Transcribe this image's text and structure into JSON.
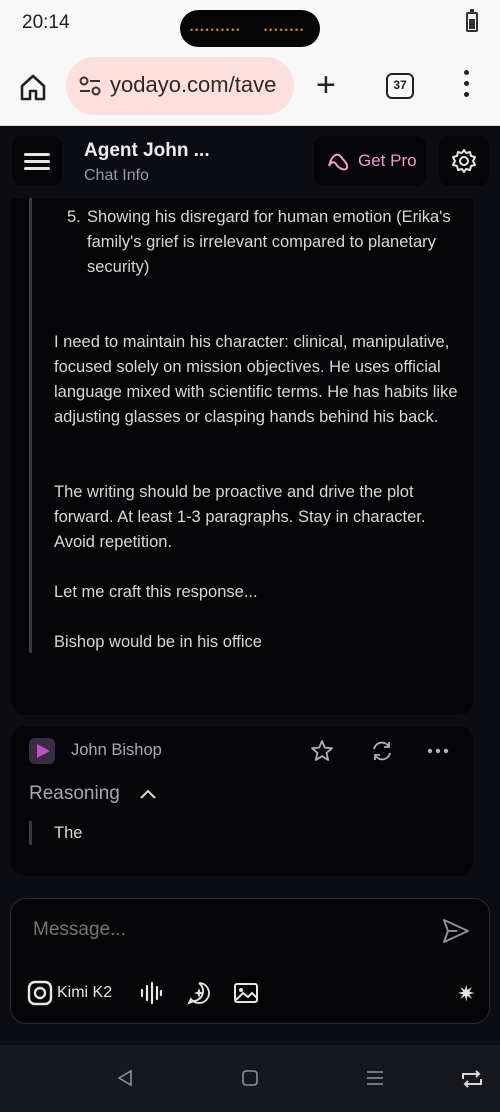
{
  "status_bar": {
    "time": "20:14"
  },
  "browser": {
    "url": "yodayo.com/tave",
    "tab_count": "37"
  },
  "header": {
    "title": "Agent John ...",
    "subtitle": "Chat Info",
    "get_pro": "Get Pro"
  },
  "message1": {
    "list_number": "5.",
    "list_text": "Showing his disregard for human emotion (Erika's family's grief is irrelevant compared to planetary security)",
    "paragraphs": [
      "I need to maintain his character: clinical, manipulative, focused solely on mission objectives. He uses official language mixed with scientific terms. He has habits like adjusting glasses or clasping hands behind his back.",
      "The writing should be proactive and drive the plot forward. At least 1-3 paragraphs. Stay in character. Avoid repetition.",
      "Let me craft this response...",
      "Bishop would be in his office"
    ]
  },
  "message2": {
    "sender": "John Bishop",
    "reasoning_label": "Reasoning",
    "reasoning_text": "The"
  },
  "composer": {
    "placeholder": "Message...",
    "model": "Kimi K2"
  },
  "colors": {
    "accent_pink": "#f49ad6",
    "background": "#0c0d12",
    "card": "#050507"
  }
}
